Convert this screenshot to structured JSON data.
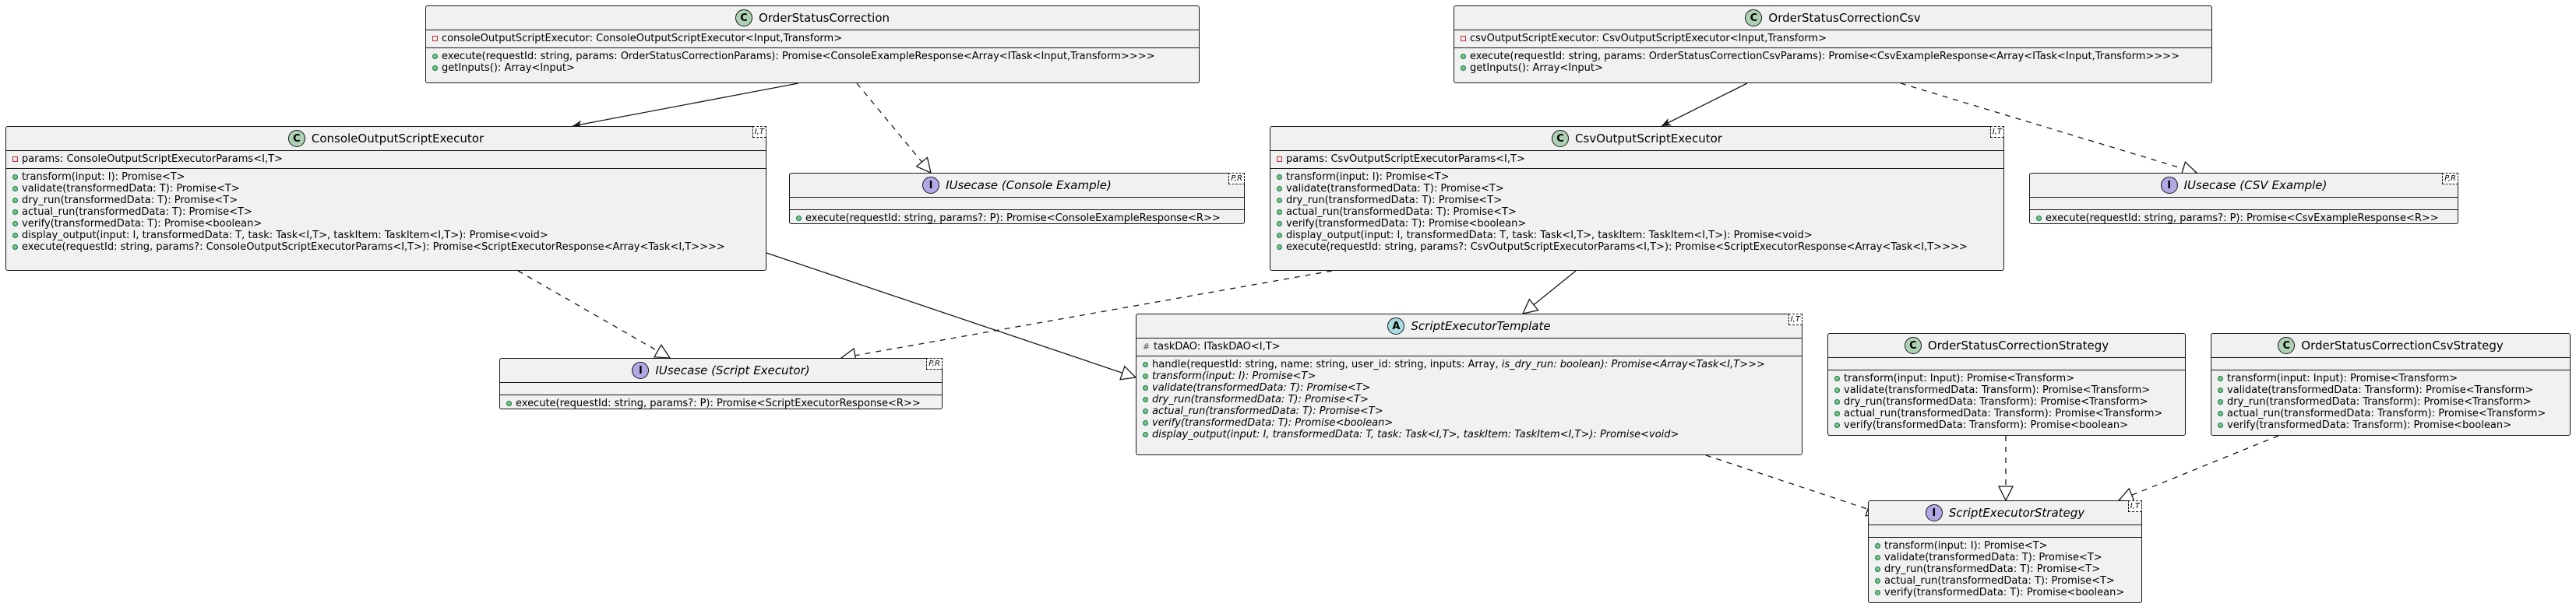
{
  "diagram": {
    "classes": [
      {
        "id": "order-status-correction",
        "kind": "C",
        "name": "OrderStatusCorrection",
        "type_params": "",
        "italic_name": false,
        "fields": [
          {
            "vis": "private",
            "text": "consoleOutputScriptExecutor: ConsoleOutputScriptExecutor<Input,Transform>",
            "italic": false
          }
        ],
        "methods": [
          {
            "vis": "public",
            "text": "execute(requestId: string, params: OrderStatusCorrectionParams): Promise<ConsoleExampleResponse<Array<ITask<Input,Transform>>>>",
            "italic": false
          },
          {
            "vis": "public",
            "text": "getInputs(): Array<Input>",
            "italic": false
          }
        ]
      },
      {
        "id": "order-status-correction-csv",
        "kind": "C",
        "name": "OrderStatusCorrectionCsv",
        "type_params": "",
        "italic_name": false,
        "fields": [
          {
            "vis": "private",
            "text": "csvOutputScriptExecutor: CsvOutputScriptExecutor<Input,Transform>",
            "italic": false
          }
        ],
        "methods": [
          {
            "vis": "public",
            "text": "execute(requestId: string, params: OrderStatusCorrectionCsvParams): Promise<CsvExampleResponse<Array<ITask<Input,Transform>>>>",
            "italic": false
          },
          {
            "vis": "public",
            "text": "getInputs(): Array<Input>",
            "italic": false
          }
        ]
      },
      {
        "id": "console-output-script-executor",
        "kind": "C",
        "name": "ConsoleOutputScriptExecutor",
        "type_params": "I,T",
        "italic_name": false,
        "fields": [
          {
            "vis": "private",
            "text": "params: ConsoleOutputScriptExecutorParams<I,T>",
            "italic": false
          }
        ],
        "methods": [
          {
            "vis": "public",
            "text": "transform(input: I): Promise<T>",
            "italic": false
          },
          {
            "vis": "public",
            "text": "validate(transformedData: T): Promise<T>",
            "italic": false
          },
          {
            "vis": "public",
            "text": "dry_run(transformedData: T): Promise<T>",
            "italic": false
          },
          {
            "vis": "public",
            "text": "actual_run(transformedData: T): Promise<T>",
            "italic": false
          },
          {
            "vis": "public",
            "text": "verify(transformedData: T): Promise<boolean>",
            "italic": false
          },
          {
            "vis": "public",
            "text": "display_output(input: I, transformedData: T, task: Task<I,T>, taskItem: TaskItem<I,T>): Promise<void>",
            "italic": false
          },
          {
            "vis": "public",
            "text": "execute(requestId: string, params?: ConsoleOutputScriptExecutorParams<I,T>): Promise<ScriptExecutorResponse<Array<Task<I,T>>>>",
            "italic": false
          }
        ]
      },
      {
        "id": "iusecase-console-example",
        "kind": "I",
        "name": "IUsecase (Console Example)",
        "type_params": "P,R",
        "italic_name": true,
        "fields": [],
        "methods": [
          {
            "vis": "public",
            "text": "execute(requestId: string, params?: P): Promise<ConsoleExampleResponse<R>>",
            "italic": false
          }
        ]
      },
      {
        "id": "csv-output-script-executor",
        "kind": "C",
        "name": "CsvOutputScriptExecutor",
        "type_params": "I,T",
        "italic_name": false,
        "fields": [
          {
            "vis": "private",
            "text": "params: CsvOutputScriptExecutorParams<I,T>",
            "italic": false
          }
        ],
        "methods": [
          {
            "vis": "public",
            "text": "transform(input: I): Promise<T>",
            "italic": false
          },
          {
            "vis": "public",
            "text": "validate(transformedData: T): Promise<T>",
            "italic": false
          },
          {
            "vis": "public",
            "text": "dry_run(transformedData: T): Promise<T>",
            "italic": false
          },
          {
            "vis": "public",
            "text": "actual_run(transformedData: T): Promise<T>",
            "italic": false
          },
          {
            "vis": "public",
            "text": "verify(transformedData: T): Promise<boolean>",
            "italic": false
          },
          {
            "vis": "public",
            "text": "display_output(input: I, transformedData: T, task: Task<I,T>, taskItem: TaskItem<I,T>): Promise<void>",
            "italic": false
          },
          {
            "vis": "public",
            "text": "execute(requestId: string, params?: CsvOutputScriptExecutorParams<I,T>): Promise<ScriptExecutorResponse<Array<Task<I,T>>>>",
            "italic": false
          }
        ]
      },
      {
        "id": "iusecase-csv-example",
        "kind": "I",
        "name": "IUsecase (CSV Example)",
        "type_params": "P,R",
        "italic_name": true,
        "fields": [],
        "methods": [
          {
            "vis": "public",
            "text": "execute(requestId: string, params?: P): Promise<CsvExampleResponse<R>>",
            "italic": false
          }
        ]
      },
      {
        "id": "iusecase-script-executor",
        "kind": "I",
        "name": "IUsecase (Script Executor)",
        "type_params": "P,R",
        "italic_name": true,
        "fields": [],
        "methods": [
          {
            "vis": "public",
            "text": "execute(requestId: string, params?: P): Promise<ScriptExecutorResponse<R>>",
            "italic": false
          }
        ]
      },
      {
        "id": "script-executor-template",
        "kind": "A",
        "name": "ScriptExecutorTemplate",
        "type_params": "I,T",
        "italic_name": true,
        "fields": [
          {
            "vis": "protected-hash",
            "text": "taskDAO: ITaskDAO<I,T>",
            "italic": false
          }
        ],
        "methods": [
          {
            "vis": "public",
            "text": "handle(requestId: string, name: string, user_id: string, inputs: Array, is_dry_run: boolean): Promise<Array<Task<I,T>>>",
            "italic": false,
            "italic_tail": "is_dry_run: boolean): Promise<Array<Task<I,T>>>"
          },
          {
            "vis": "public",
            "text": "transform(input: I): Promise<T>",
            "italic": true
          },
          {
            "vis": "public",
            "text": "validate(transformedData: T): Promise<T>",
            "italic": true
          },
          {
            "vis": "public",
            "text": "dry_run(transformedData: T): Promise<T>",
            "italic": true
          },
          {
            "vis": "public",
            "text": "actual_run(transformedData: T): Promise<T>",
            "italic": true
          },
          {
            "vis": "public",
            "text": "verify(transformedData: T): Promise<boolean>",
            "italic": true
          },
          {
            "vis": "public",
            "text": "display_output(input: I, transformedData: T, task: Task<I,T>, taskItem: TaskItem<I,T>): Promise<void>",
            "italic": true
          }
        ]
      },
      {
        "id": "order-status-correction-strategy",
        "kind": "C",
        "name": "OrderStatusCorrectionStrategy",
        "type_params": "",
        "italic_name": false,
        "fields": [],
        "methods": [
          {
            "vis": "public",
            "text": "transform(input: Input): Promise<Transform>",
            "italic": false
          },
          {
            "vis": "public",
            "text": "validate(transformedData: Transform): Promise<Transform>",
            "italic": false
          },
          {
            "vis": "public",
            "text": "dry_run(transformedData: Transform): Promise<Transform>",
            "italic": false
          },
          {
            "vis": "public",
            "text": "actual_run(transformedData: Transform): Promise<Transform>",
            "italic": false
          },
          {
            "vis": "public",
            "text": "verify(transformedData: Transform): Promise<boolean>",
            "italic": false
          }
        ]
      },
      {
        "id": "order-status-correction-csv-strategy",
        "kind": "C",
        "name": "OrderStatusCorrectionCsvStrategy",
        "type_params": "",
        "italic_name": false,
        "fields": [],
        "methods": [
          {
            "vis": "public",
            "text": "transform(input: Input): Promise<Transform>",
            "italic": false
          },
          {
            "vis": "public",
            "text": "validate(transformedData: Transform): Promise<Transform>",
            "italic": false
          },
          {
            "vis": "public",
            "text": "dry_run(transformedData: Transform): Promise<Transform>",
            "italic": false
          },
          {
            "vis": "public",
            "text": "actual_run(transformedData: Transform): Promise<Transform>",
            "italic": false
          },
          {
            "vis": "public",
            "text": "verify(transformedData: Transform): Promise<boolean>",
            "italic": false
          }
        ]
      },
      {
        "id": "script-executor-strategy",
        "kind": "I",
        "name": "ScriptExecutorStrategy",
        "type_params": "I,T",
        "italic_name": true,
        "fields": [],
        "methods": [
          {
            "vis": "public",
            "text": "transform(input: I): Promise<T>",
            "italic": false
          },
          {
            "vis": "public",
            "text": "validate(transformedData: T): Promise<T>",
            "italic": false
          },
          {
            "vis": "public",
            "text": "dry_run(transformedData: T): Promise<T>",
            "italic": false
          },
          {
            "vis": "public",
            "text": "actual_run(transformedData: T): Promise<T>",
            "italic": false
          },
          {
            "vis": "public",
            "text": "verify(transformedData: T): Promise<boolean>",
            "italic": false
          }
        ]
      }
    ],
    "relations": [
      {
        "from": "order-status-correction",
        "to": "console-output-script-executor",
        "type": "association"
      },
      {
        "from": "order-status-correction",
        "to": "iusecase-console-example",
        "type": "realization"
      },
      {
        "from": "order-status-correction-csv",
        "to": "csv-output-script-executor",
        "type": "association"
      },
      {
        "from": "order-status-correction-csv",
        "to": "iusecase-csv-example",
        "type": "realization"
      },
      {
        "from": "console-output-script-executor",
        "to": "script-executor-template",
        "type": "generalization"
      },
      {
        "from": "console-output-script-executor",
        "to": "iusecase-script-executor",
        "type": "realization"
      },
      {
        "from": "csv-output-script-executor",
        "to": "script-executor-template",
        "type": "generalization"
      },
      {
        "from": "csv-output-script-executor",
        "to": "iusecase-script-executor",
        "type": "realization"
      },
      {
        "from": "script-executor-template",
        "to": "script-executor-strategy",
        "type": "realization"
      },
      {
        "from": "order-status-correction-strategy",
        "to": "script-executor-strategy",
        "type": "realization"
      },
      {
        "from": "order-status-correction-csv-strategy",
        "to": "script-executor-strategy",
        "type": "realization"
      }
    ]
  }
}
